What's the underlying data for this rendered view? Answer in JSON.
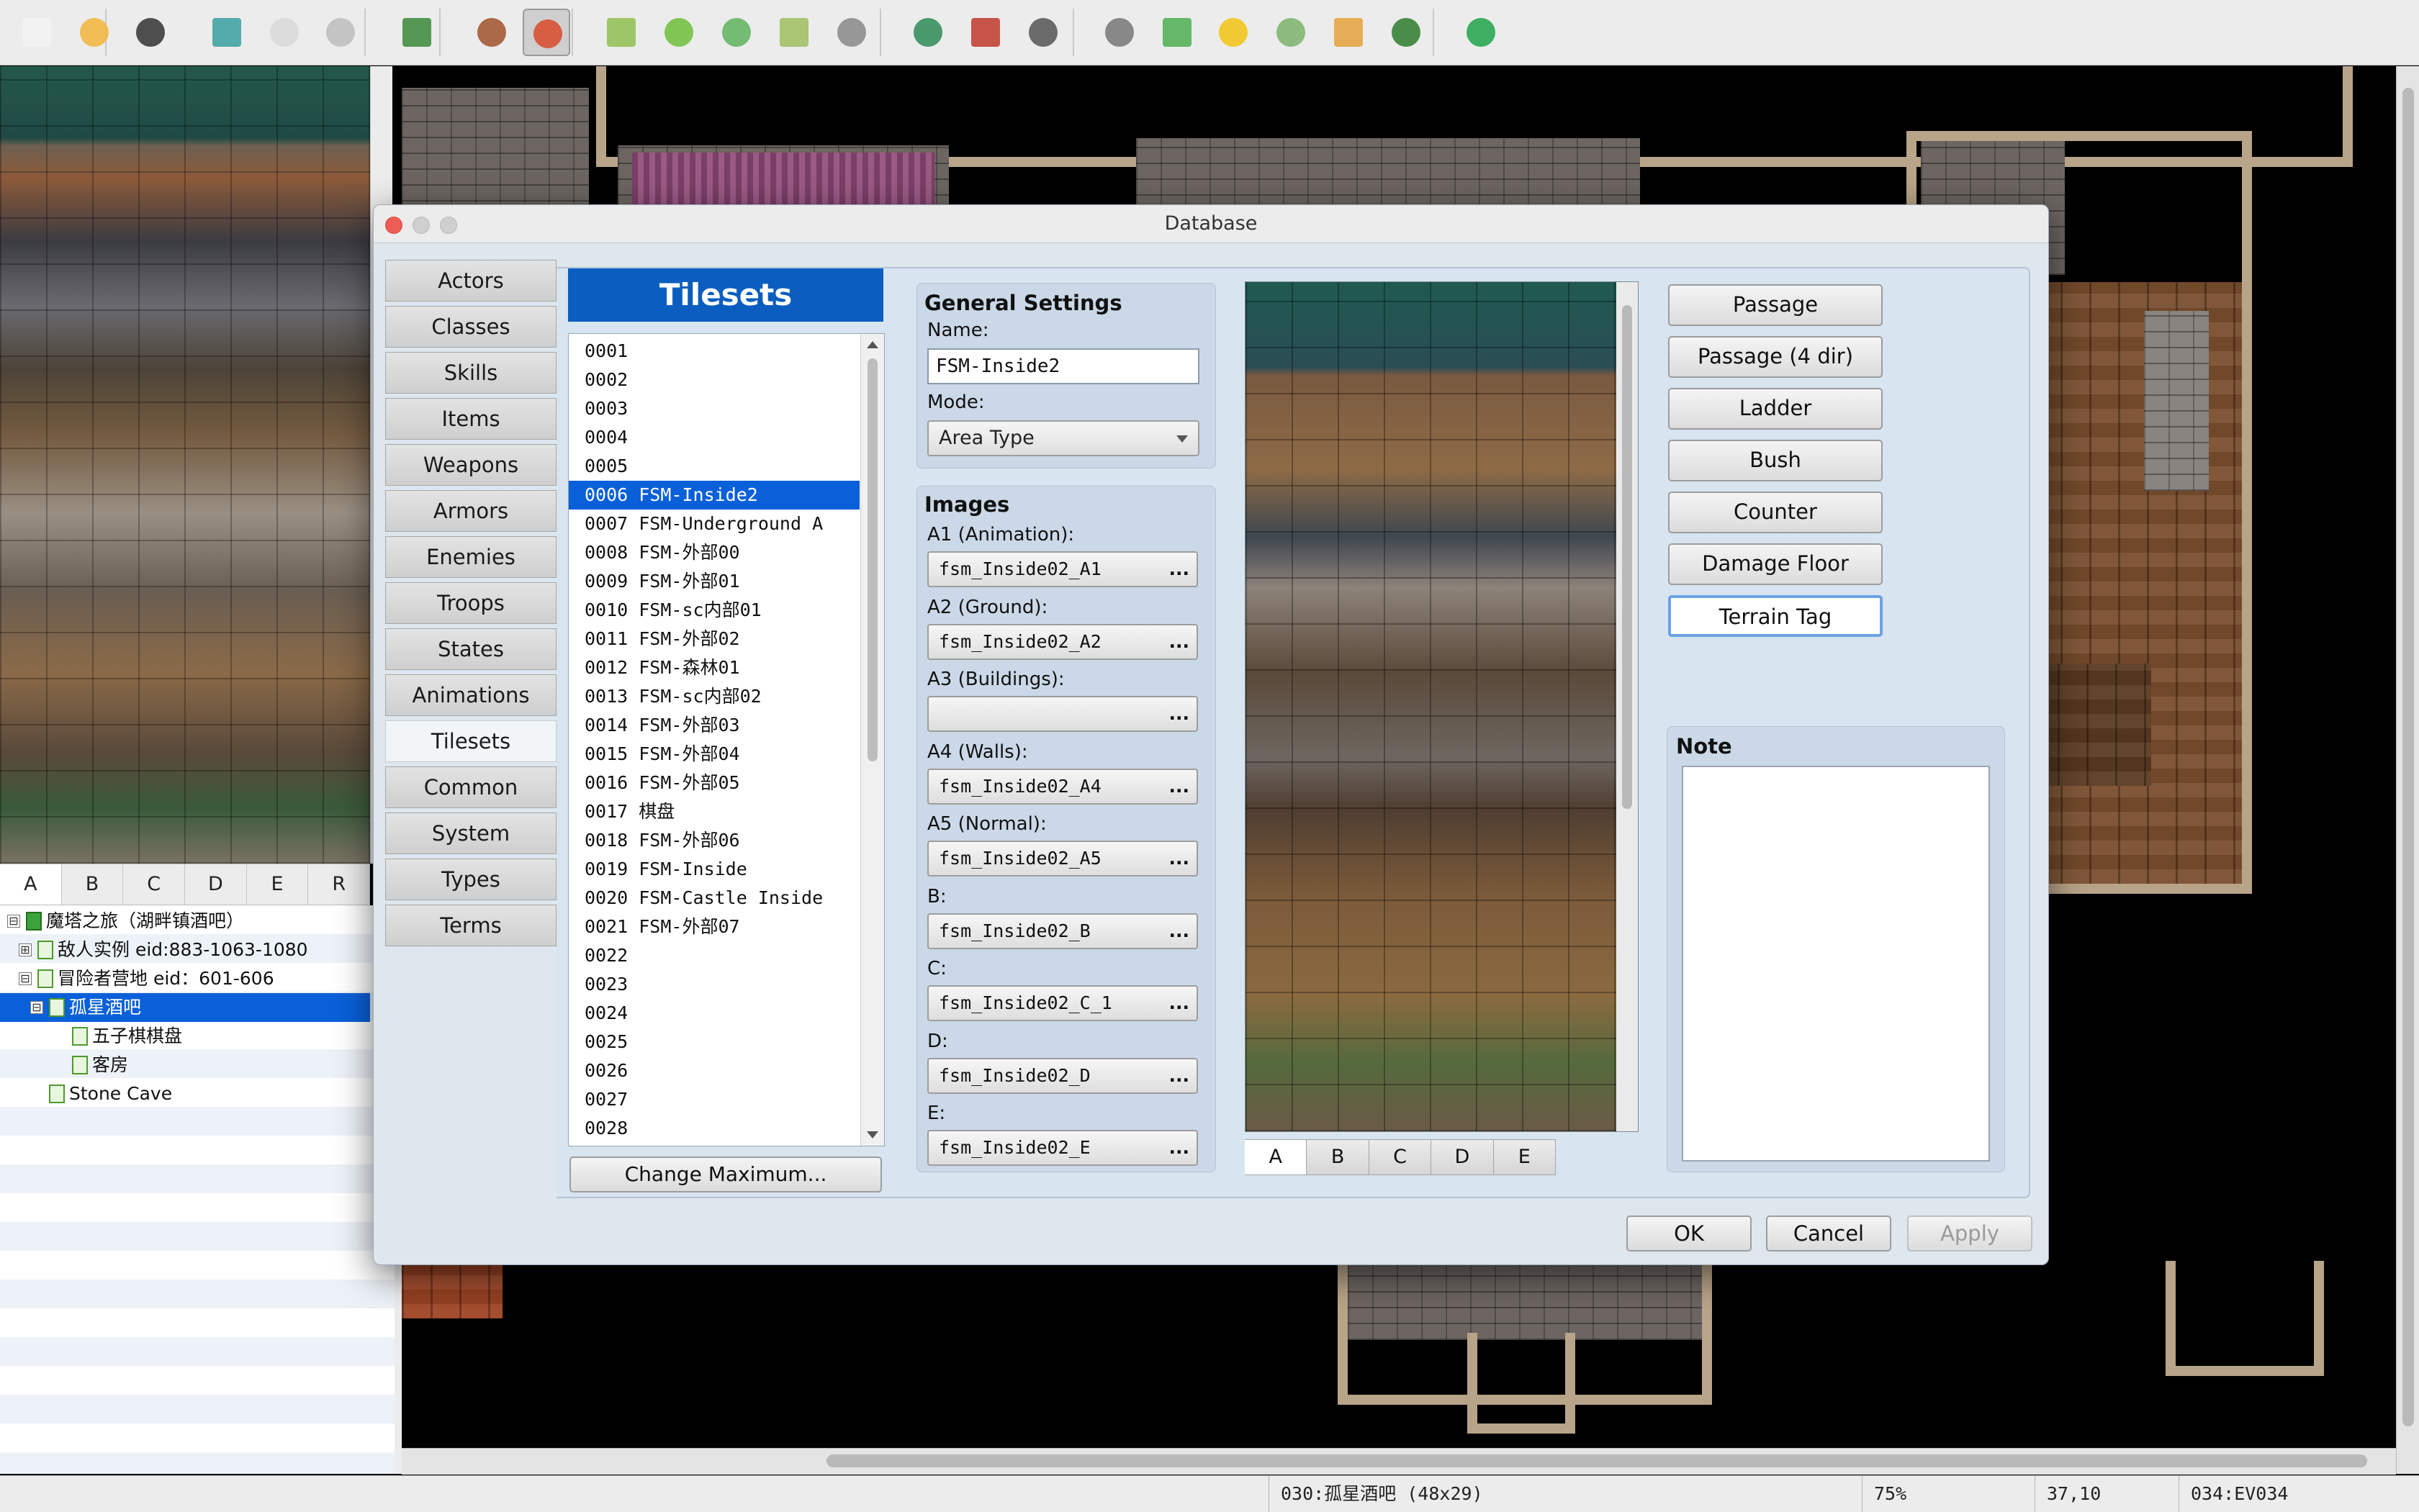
{
  "toolbar": {
    "icons": [
      "new-icon",
      "open-icon",
      "save-icon",
      "cut-icon",
      "copy-icon",
      "paste-icon",
      "undo-icon",
      "map-mode-icon",
      "event-mode-icon",
      "pencil-icon",
      "rectangle-icon",
      "ellipse-icon",
      "fill-icon",
      "shadow-pen-icon",
      "zoom-in-icon",
      "zoom-out-icon",
      "zoom-actual-icon",
      "database-icon",
      "plugin-manager-icon",
      "sound-test-icon",
      "event-searcher-icon",
      "resource-manager-icon",
      "character-generator-icon",
      "playtest-icon"
    ]
  },
  "palette": {
    "tabs": [
      "A",
      "B",
      "C",
      "D",
      "E",
      "R"
    ],
    "selected_tab": "A"
  },
  "map_tree": {
    "items": [
      {
        "label": "魔塔之旅（湖畔镇酒吧）",
        "expander": "⊟"
      },
      {
        "label": "敌人实例 eid:883-1063-1080",
        "expander": "⊞"
      },
      {
        "label": "冒险者营地 eid：601-606",
        "expander": "⊟"
      },
      {
        "label": "孤星酒吧",
        "expander": "⊟"
      },
      {
        "label": "五子棋棋盘",
        "expander": ""
      },
      {
        "label": "客房",
        "expander": ""
      },
      {
        "label": "Stone Cave",
        "expander": ""
      }
    ]
  },
  "status_bar": {
    "map": "030:孤星酒吧 (48x29)",
    "zoom": "75%",
    "coords": "37,10",
    "event": "034:EV034"
  },
  "dialog": {
    "title": "Database",
    "categories": [
      "Actors",
      "Classes",
      "Skills",
      "Items",
      "Weapons",
      "Armors",
      "Enemies",
      "Troops",
      "States",
      "Animations",
      "Tilesets",
      "Common Events",
      "System",
      "Types",
      "Terms"
    ],
    "selected_category": "Tilesets",
    "list_header": "Tilesets",
    "list": [
      "0001",
      "0002",
      "0003",
      "0004",
      "0005",
      "0006 FSM-Inside2",
      "0007 FSM-Underground A",
      "0008 FSM-外部00",
      "0009 FSM-外部01",
      "0010 FSM-sc内部01",
      "0011 FSM-外部02",
      "0012 FSM-森林01",
      "0013 FSM-sc内部02",
      "0014 FSM-外部03",
      "0015 FSM-外部04",
      "0016 FSM-外部05",
      "0017 棋盘",
      "0018 FSM-外部06",
      "0019 FSM-Inside",
      "0020 FSM-Castle Inside",
      "0021 FSM-外部07",
      "0022",
      "0023",
      "0024",
      "0025",
      "0026",
      "0027",
      "0028"
    ],
    "selected_index": 5,
    "change_max_label": "Change Maximum...",
    "general": {
      "heading": "General Settings",
      "name_label": "Name:",
      "name_value": "FSM-Inside2",
      "mode_label": "Mode:",
      "mode_value": "Area Type"
    },
    "images": {
      "heading": "Images",
      "fields": [
        {
          "label": "A1 (Animation):",
          "value": "fsm_Inside02_A1"
        },
        {
          "label": "A2 (Ground):",
          "value": "fsm_Inside02_A2"
        },
        {
          "label": "A3 (Buildings):",
          "value": ""
        },
        {
          "label": "A4 (Walls):",
          "value": "fsm_Inside02_A4"
        },
        {
          "label": "A5 (Normal):",
          "value": "fsm_Inside02_A5"
        },
        {
          "label": "B:",
          "value": "fsm_Inside02_B"
        },
        {
          "label": "C:",
          "value": "fsm_Inside02_C_1"
        },
        {
          "label": "D:",
          "value": "fsm_Inside02_D"
        },
        {
          "label": "E:",
          "value": "fsm_Inside02_E"
        }
      ],
      "browse": "..."
    },
    "tile_tabs": [
      "A",
      "B",
      "C",
      "D",
      "E"
    ],
    "tile_selected_tab": "A",
    "flag_buttons": [
      "Passage",
      "Passage (4 dir)",
      "Ladder",
      "Bush",
      "Counter",
      "Damage Floor",
      "Terrain Tag"
    ],
    "focused_flag": "Terrain Tag",
    "note_label": "Note",
    "ok": "OK",
    "cancel": "Cancel",
    "apply": "Apply"
  }
}
